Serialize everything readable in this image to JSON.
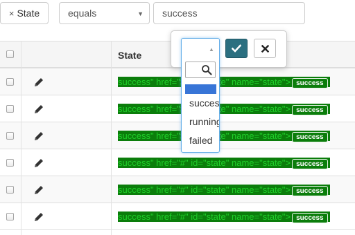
{
  "filter": {
    "field_label": "State",
    "remove_glyph": "×",
    "operator": "equals",
    "value": "success"
  },
  "table": {
    "header_state": "State",
    "rows": [
      {
        "raw_text": "success\" href=\"#\" id=\"state\" name=\"state\">",
        "badge": "success"
      },
      {
        "raw_text": "success\" href=\"#\" id=\"state\" name=\"state\">",
        "badge": "success"
      },
      {
        "raw_text": "success\" href=\"#\" id=\"state\" name=\"state\">",
        "badge": "success"
      },
      {
        "raw_text": "success\" href=\"#\" id=\"state\" name=\"state\">",
        "badge": "success"
      },
      {
        "raw_text": "success\" href=\"#\" id=\"state\" name=\"state\">",
        "badge": "success"
      },
      {
        "raw_text": "success\" href=\"#\" id=\"state\" name=\"state\">",
        "badge": "success"
      }
    ]
  },
  "editor": {
    "selected": "",
    "options": [
      "success",
      "running",
      "failed"
    ],
    "ok_icon": "check-icon",
    "cancel_icon": "close-icon"
  },
  "colors": {
    "state_bg": "#0b7d0b",
    "state_text": "#1fd02a",
    "ok_button": "#2b6f80",
    "highlight": "#3875d7"
  }
}
